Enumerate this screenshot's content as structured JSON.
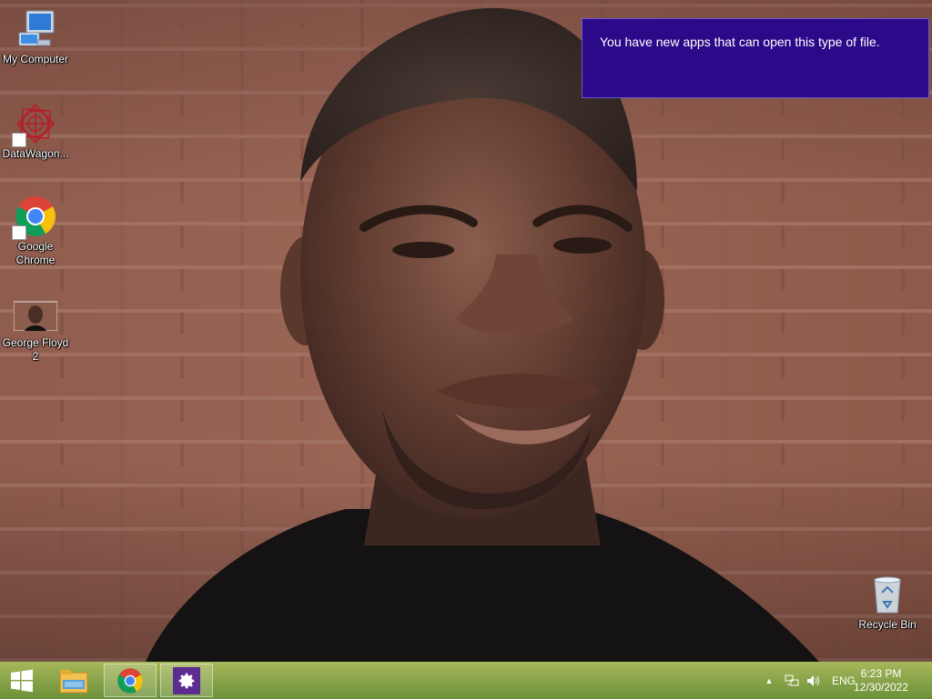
{
  "desktop": {
    "icons": [
      {
        "label": "My Computer"
      },
      {
        "label": "DataWagon..."
      },
      {
        "label": "Google Chrome"
      },
      {
        "label": "George Floyd 2"
      },
      {
        "label": "Recycle Bin"
      }
    ]
  },
  "toast": {
    "message": "You have new apps that can open this type of file."
  },
  "taskbar": {
    "start_icon": "windows-logo-icon",
    "pinned": [
      {
        "icon": "file-explorer-icon"
      },
      {
        "icon": "chrome-icon"
      },
      {
        "icon": "settings-gear-icon"
      }
    ],
    "tray": {
      "language": "ENG",
      "time": "6:23 PM",
      "date": "12/30/2022"
    }
  },
  "colors": {
    "toast_bg": "#2b0a8a",
    "taskbar": "#6f9a2f",
    "brick": "#9b6656"
  }
}
